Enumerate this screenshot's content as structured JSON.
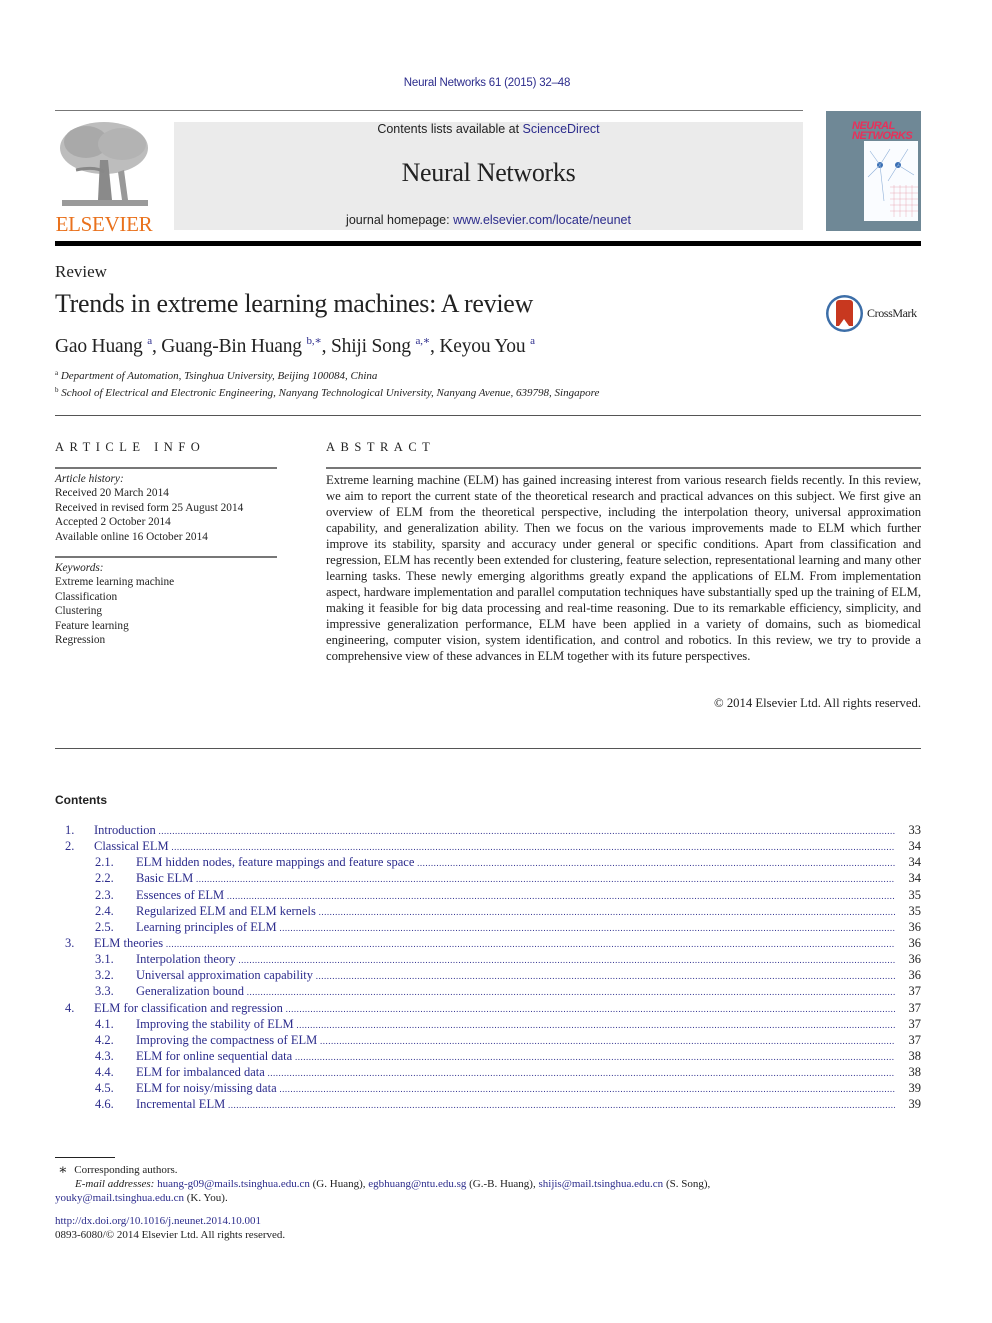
{
  "citation": "Neural Networks 61 (2015) 32–48",
  "header": {
    "publisher_logo_text": "ELSEVIER",
    "contents_available_prefix": "Contents lists available at ",
    "contents_available_link": "ScienceDirect",
    "journal_name": "Neural Networks",
    "homepage_prefix": "journal homepage: ",
    "homepage_link": "www.elsevier.com/locate/neunet",
    "cover_title_line1": "NEURAL",
    "cover_title_line2": "NETWORKS"
  },
  "article": {
    "type": "Review",
    "title": "Trends in extreme learning machines: A review",
    "crossmark_label": "CrossMark",
    "authors": [
      {
        "name": "Gao Huang",
        "sup": "a"
      },
      {
        "name": "Guang-Bin Huang",
        "sup": "b,∗"
      },
      {
        "name": "Shiji Song",
        "sup": "a,∗"
      },
      {
        "name": "Keyou You",
        "sup": "a"
      }
    ],
    "separator": ", ",
    "affiliations": [
      {
        "mark": "a",
        "text": "Department of Automation, Tsinghua University, Beijing 100084, China"
      },
      {
        "mark": "b",
        "text": "School of Electrical and Electronic Engineering, Nanyang Technological University, Nanyang Avenue, 639798, Singapore"
      }
    ]
  },
  "article_info": {
    "heading": "ARTICLE INFO",
    "history_label": "Article history:",
    "history": [
      "Received 20 March 2014",
      "Received in revised form 25 August 2014",
      "Accepted 2 October 2014",
      "Available online 16 October 2014"
    ],
    "keywords_label": "Keywords:",
    "keywords": [
      "Extreme learning machine",
      "Classification",
      "Clustering",
      "Feature learning",
      "Regression"
    ]
  },
  "abstract": {
    "heading": "ABSTRACT",
    "text": "Extreme learning machine (ELM) has gained increasing interest from various research fields recently. In this review, we aim to report the current state of the theoretical research and practical advances on this subject. We first give an overview of ELM from the theoretical perspective, including the interpolation theory, universal approximation capability, and generalization ability. Then we focus on the various improvements made to ELM which further improve its stability, sparsity and accuracy under general or specific conditions. Apart from classification and regression, ELM has recently been extended for clustering, feature selection, representational learning and many other learning tasks. These newly emerging algorithms greatly expand the applications of ELM. From implementation aspect, hardware implementation and parallel computation techniques have substantially sped up the training of ELM, making it feasible for big data processing and real-time reasoning. Due to its remarkable efficiency, simplicity, and impressive generalization performance, ELM have been applied in a variety of domains, such as biomedical engineering, computer vision, system identification, and control and robotics. In this review, we try to provide a comprehensive view of these advances in ELM together with its future perspectives.",
    "copyright": "© 2014 Elsevier Ltd. All rights reserved."
  },
  "contents": {
    "heading": "Contents",
    "entries": [
      {
        "level": 1,
        "num": "1.",
        "title": "Introduction",
        "page": "33"
      },
      {
        "level": 1,
        "num": "2.",
        "title": "Classical ELM",
        "page": "34"
      },
      {
        "level": 2,
        "num": "2.1.",
        "title": "ELM hidden nodes, feature mappings and feature space",
        "page": "34"
      },
      {
        "level": 2,
        "num": "2.2.",
        "title": "Basic ELM",
        "page": "34"
      },
      {
        "level": 2,
        "num": "2.3.",
        "title": "Essences of ELM",
        "page": "35"
      },
      {
        "level": 2,
        "num": "2.4.",
        "title": "Regularized ELM and ELM kernels",
        "page": "35"
      },
      {
        "level": 2,
        "num": "2.5.",
        "title": "Learning principles of ELM",
        "page": "36"
      },
      {
        "level": 1,
        "num": "3.",
        "title": "ELM theories",
        "page": "36"
      },
      {
        "level": 2,
        "num": "3.1.",
        "title": "Interpolation theory",
        "page": "36"
      },
      {
        "level": 2,
        "num": "3.2.",
        "title": "Universal approximation capability",
        "page": "36"
      },
      {
        "level": 2,
        "num": "3.3.",
        "title": "Generalization bound",
        "page": "37"
      },
      {
        "level": 1,
        "num": "4.",
        "title": "ELM for classification and regression",
        "page": "37"
      },
      {
        "level": 2,
        "num": "4.1.",
        "title": "Improving the stability of ELM",
        "page": "37"
      },
      {
        "level": 2,
        "num": "4.2.",
        "title": "Improving the compactness of ELM",
        "page": "37"
      },
      {
        "level": 2,
        "num": "4.3.",
        "title": "ELM for online sequential data",
        "page": "38"
      },
      {
        "level": 2,
        "num": "4.4.",
        "title": "ELM for imbalanced data",
        "page": "38"
      },
      {
        "level": 2,
        "num": "4.5.",
        "title": "ELM for noisy/missing data",
        "page": "39"
      },
      {
        "level": 2,
        "num": "4.6.",
        "title": "Incremental ELM",
        "page": "39"
      }
    ]
  },
  "footnotes": {
    "star": "∗",
    "corresponding": "Corresponding authors.",
    "email_label": "E-mail addresses:",
    "emails": [
      {
        "address": "huang-g09@mails.tsinghua.edu.cn",
        "who": "(G. Huang)"
      },
      {
        "address": "egbhuang@ntu.edu.sg",
        "who": "(G.-B. Huang)"
      },
      {
        "address": "shijis@mail.tsinghua.edu.cn",
        "who": "(S. Song)"
      },
      {
        "address": "youky@mail.tsinghua.edu.cn",
        "who": "(K. You)."
      }
    ],
    "doi": "http://dx.doi.org/10.1016/j.neunet.2014.10.001",
    "issn": "0893-6080/© 2014 Elsevier Ltd. All rights reserved."
  },
  "colors": {
    "link": "#2c2c8c",
    "elsevier_orange": "#e9711c",
    "journal_box_bg": "#ebebeb",
    "cover_bg": "#6f8896",
    "cover_title": "#e8305a",
    "crossmark_red": "#c8381f"
  }
}
